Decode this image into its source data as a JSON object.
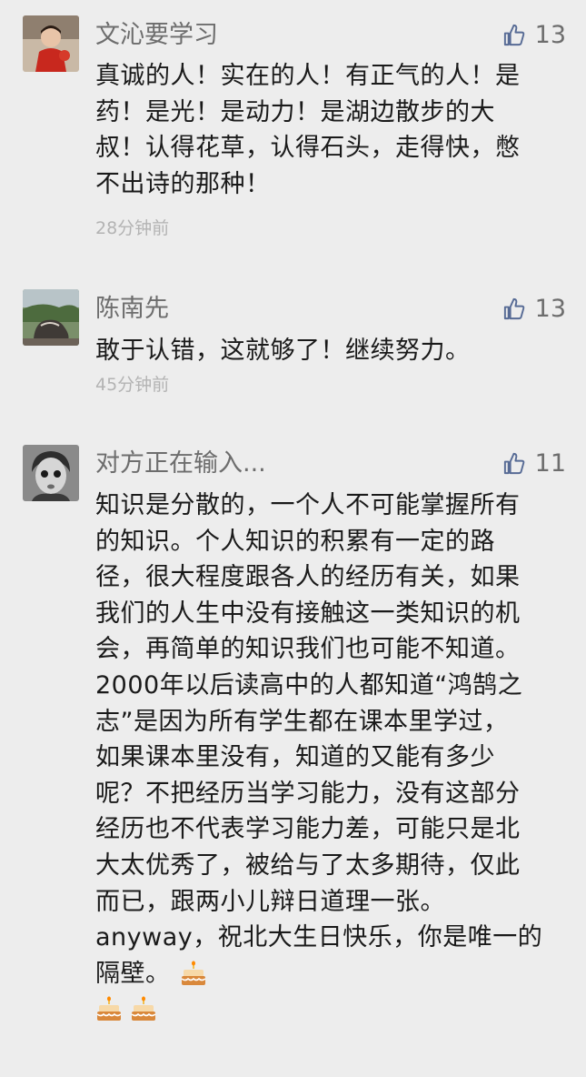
{
  "comments": [
    {
      "name": "文沁要学习",
      "likes": "13",
      "lines": [
        "真诚的人！实在的人！有正气的人！是",
        "药！是光！是动力！是湖边散步的大",
        "叔！认得花草，认得石头，走得快，憋",
        "不出诗的那种！"
      ],
      "time": "28分钟前",
      "avatar_icon": "child-in-red-avatar"
    },
    {
      "name": "陈南先",
      "likes": "13",
      "lines": [
        "敢于认错，这就够了！继续努力。"
      ],
      "time": "45分钟前",
      "avatar_icon": "rock-landscape-avatar"
    },
    {
      "name": "对方正在输入...",
      "likes": "11",
      "lines": [
        "知识是分散的，一个人不可能掌握所有",
        "的知识。个人知识的积累有一定的路",
        "径，很大程度跟各人的经历有关，如果",
        "我们的人生中没有接触这一类知识的机",
        "会，再简单的知识我们也可能不知道。",
        "2000年以后读高中的人都知道“鸿鹄之",
        "志”是因为所有学生都在课本里学过，",
        "如果课本里没有，知道的又能有多少",
        "呢？不把经历当学习能力，没有这部分",
        "经历也不代表学习能力差，可能只是北",
        "大太优秀了，被给与了太多期待，仅此",
        "而已，跟两小儿辩日道理一张。",
        "anyway，祝北大生日快乐，你是唯一的",
        "隔壁。"
      ],
      "avatar_icon": "boy-portrait-avatar"
    }
  ],
  "icons": {
    "like": "thumbs-up-icon",
    "cake": "birthday-cake-emoji"
  },
  "colors": {
    "background": "#ededed",
    "text": "#1a1a1a",
    "meta": "#6d6d6d",
    "time": "#b3b3b3",
    "like_blue": "#576b95"
  }
}
